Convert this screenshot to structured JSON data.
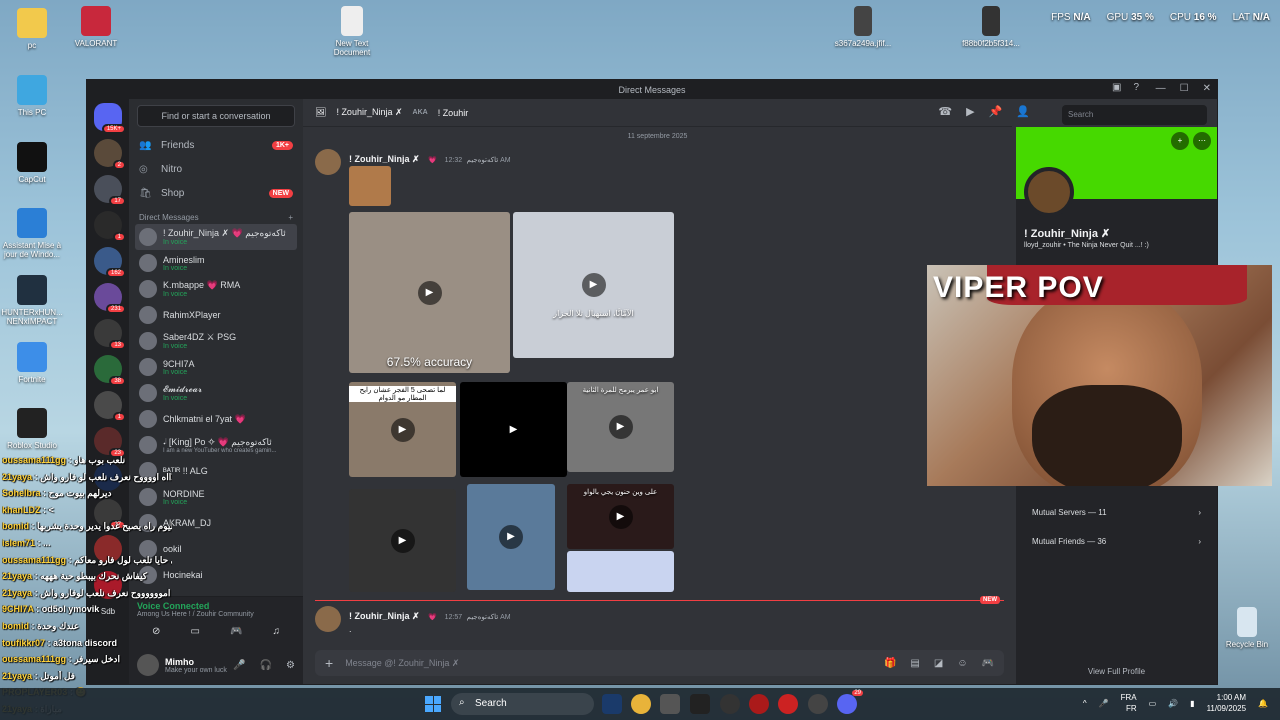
{
  "desktop": {
    "icons": [
      {
        "label": "pc",
        "color": "#f2c94c"
      },
      {
        "label": "VALORANT",
        "color": "#c8283c"
      },
      {
        "label": "New Text Document",
        "color": "#eeeeee"
      },
      {
        "label": "s367a249a.jfif...",
        "color": "#444444"
      },
      {
        "label": "f88b0f2b5f314...",
        "color": "#333333"
      },
      {
        "label": "This PC",
        "color": "#3fa7e0"
      },
      {
        "label": "CapCut",
        "color": "#111111"
      },
      {
        "label": "Assistant Mise à jour de Windo...",
        "color": "#2b7fd6"
      },
      {
        "label": "HUNTERxHUN... NENxIMPACT",
        "color": "#203040"
      },
      {
        "label": "Fortnite",
        "color": "#3d8ee8"
      },
      {
        "label": "Roblox Studio",
        "color": "#222222"
      },
      {
        "label": "Recycle Bin",
        "color": "#d8e6f0"
      }
    ],
    "stats": {
      "fps_label": "FPS",
      "fps": "N/A",
      "gpu_label": "GPU",
      "gpu": "35 %",
      "cpu_label": "CPU",
      "cpu": "16 %",
      "lat_label": "LAT",
      "lat": "N/A"
    }
  },
  "window": {
    "title": "Direct Messages",
    "side": {
      "search_placeholder": "Find or start a conversation",
      "nav": [
        {
          "label": "Friends",
          "badge": "1K+"
        },
        {
          "label": "Nitro",
          "badge": ""
        },
        {
          "label": "Shop",
          "badge": "NEW"
        }
      ],
      "dm_header": "Direct Messages",
      "dms": [
        {
          "name": "! Zouhir_Ninja ✗ 💗 ئاكەتوەجيم",
          "status": "In voice",
          "active": true
        },
        {
          "name": "Amineslim",
          "status": "In voice"
        },
        {
          "name": "K.mbappe 💗 RMA",
          "status": "In voice"
        },
        {
          "name": "RahimXPlayer",
          "status": ""
        },
        {
          "name": "Saber4DZ ⚔ PSG",
          "status": "In voice"
        },
        {
          "name": "9CHI7A",
          "status": "In voice"
        },
        {
          "name": "𝓔𝓶𝓲𝓭𝓻𝓮𝓪𝓻",
          "status": "In voice"
        },
        {
          "name": "Chlkmatni el 7yat 💗",
          "status": ""
        },
        {
          "name": "𝆺𝅥 [King] Po ✧ 💗 ئاكەتوەجيم",
          "status": "I am a new YouTuber who creates gamin..."
        },
        {
          "name": "ᴮᴬᵀᴵᴿ !! ALG",
          "status": ""
        },
        {
          "name": "NORDINE",
          "status": "In voice"
        },
        {
          "name": "AKRAM_DJ",
          "status": ""
        },
        {
          "name": "ookil",
          "status": ""
        },
        {
          "name": "Hocinekai",
          "status": ""
        }
      ],
      "voice": {
        "title": "Voice Connected",
        "sub": "Among Us Here ! / Zouhir Community"
      },
      "user": {
        "name": "Mimho",
        "status": "Make your own luck"
      }
    },
    "guild_badges": [
      "15K+",
      "2",
      "17",
      "1",
      "162",
      "231",
      "13",
      "38",
      "1",
      "23",
      "",
      "27",
      "",
      "",
      "",
      ""
    ],
    "guild_label": "Sdb",
    "chat": {
      "header_name": "! Zouhir_Ninja ✗",
      "aka_label": "AKA",
      "aka_name": "! Zouhir",
      "search_placeholder": "Search",
      "date_divider": "11 septembre 2025",
      "messages": [
        {
          "author": "! Zouhir_Ninja ✗",
          "tag": "💗 ئاكەتوەجيم",
          "time": "12:32 AM"
        },
        {
          "author": "! Zouhir_Ninja ✗",
          "tag": "💗 ئاكەتوەجيم",
          "time": "12:57 AM",
          "text": "."
        }
      ],
      "media": [
        {
          "caption": "67.5% accuracy"
        },
        {
          "caption": "الآمَّانَّا، استهبال تلا الجزار"
        },
        {
          "caption": "لما تصحى 5 الفجر عشان رايح المطار مو الدوام"
        },
        {
          "caption": ""
        },
        {
          "caption": "ابو عمر يبرمج للمرة الثانية"
        },
        {
          "caption": ""
        },
        {
          "caption": ""
        },
        {
          "caption": "علی وین حنون يجي بالواو"
        },
        {
          "caption": ""
        },
        {
          "caption": ""
        }
      ],
      "new_label": "NEW",
      "composer_placeholder": "Message @! Zouhir_Ninja ✗"
    },
    "profile": {
      "name": "! Zouhir_Ninja ✗",
      "sub": "lloyd_zouhir • The Ninja Never Quit ...! :)",
      "mutual_servers": "Mutual Servers — 11",
      "mutual_friends": "Mutual Friends — 36",
      "view_full": "View Full Profile",
      "banner_color": "#46d900"
    }
  },
  "cam": {
    "label": "VIPER POV"
  },
  "stream_chat": [
    {
      "user": "oussama111gg",
      "text": ": نلعب بوب هاو"
    },
    {
      "user": "21yaya",
      "text": ": الاااه اووووح نعرف نلعب لو فارو واش"
    },
    {
      "user": "Sohelbra",
      "text": ": ديرلهم بيوت موح"
    },
    {
      "user": "khanLDZ",
      "text": ": <"
    },
    {
      "user": "bomid",
      "text": ": اليوم راه يصبح غدوا يدير وحدة يشربها"
    },
    {
      "user": "islem71",
      "text": ": ..."
    },
    {
      "user": "oussama111gg",
      "text": ": زارني حايا تلعب لول فارو معاكم"
    },
    {
      "user": "21yaya",
      "text": ": كيفاش نحرك بيبطو حية هههه"
    },
    {
      "user": "21yaya",
      "text": ": امووووووح نعرف نلعب لوفارو واش"
    },
    {
      "user": "9CHI7A",
      "text": ": od5ol ymovik"
    },
    {
      "user": "bomid",
      "text": ": عندك وحدة"
    },
    {
      "user": "toufikkr07",
      "text": ": a3tona discord"
    },
    {
      "user": "oussama111gg",
      "text": ": ادخل سيرفر"
    },
    {
      "user": "21yaya",
      "text": ": فل أموتل"
    },
    {
      "user": "PROPLAYER03",
      "text": ": 😊"
    },
    {
      "user": "21yaya",
      "text": ": مباراة"
    }
  ],
  "taskbar": {
    "search": "Search",
    "lang_top": "FRA",
    "lang_bottom": "FR",
    "time": "1:00 AM",
    "date": "11/09/2025",
    "discord_badge": "29"
  }
}
